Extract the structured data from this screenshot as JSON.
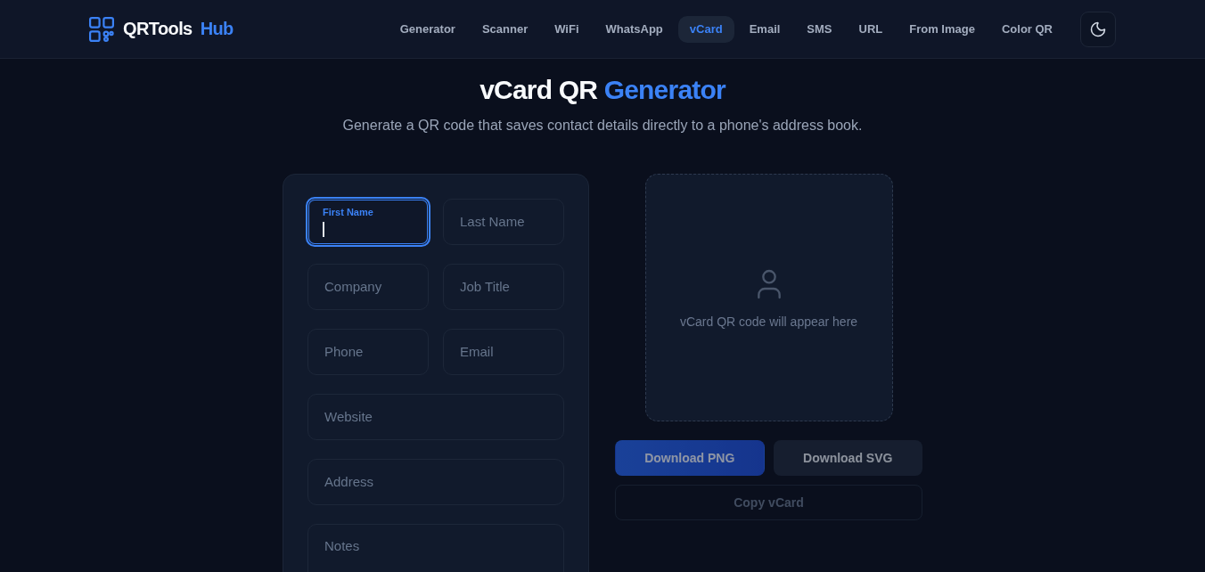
{
  "header": {
    "logo": {
      "name": "QRTools",
      "accent": "Hub"
    },
    "nav": [
      {
        "label": "Generator",
        "selected": false
      },
      {
        "label": "Scanner",
        "selected": false
      },
      {
        "label": "WiFi",
        "selected": false
      },
      {
        "label": "WhatsApp",
        "selected": false
      },
      {
        "label": "vCard",
        "selected": true
      },
      {
        "label": "Email",
        "selected": false
      },
      {
        "label": "SMS",
        "selected": false
      },
      {
        "label": "URL",
        "selected": false
      },
      {
        "label": "From Image",
        "selected": false
      },
      {
        "label": "Color QR",
        "selected": false
      }
    ]
  },
  "hero": {
    "title": "vCard QR",
    "title_accent": "Generator",
    "subtitle": "Generate a QR code that saves contact details directly to a phone's address book."
  },
  "form": {
    "rows": [
      {
        "fields": [
          {
            "label": "First Name",
            "kind": "text",
            "focused": true
          },
          {
            "label": "Last Name",
            "kind": "text",
            "focused": false
          }
        ]
      },
      {
        "fields": [
          {
            "label": "Company",
            "kind": "text",
            "focused": false
          },
          {
            "label": "Job Title",
            "kind": "text",
            "focused": false
          }
        ]
      },
      {
        "fields": [
          {
            "label": "Phone",
            "kind": "text",
            "focused": false
          },
          {
            "label": "Email",
            "kind": "text",
            "focused": false
          }
        ]
      },
      {
        "fields": [
          {
            "label": "Website",
            "kind": "text",
            "focused": false
          }
        ]
      },
      {
        "fields": [
          {
            "label": "Address",
            "kind": "text",
            "focused": false
          }
        ]
      },
      {
        "fields": [
          {
            "label": "Notes",
            "kind": "textarea",
            "focused": false
          }
        ]
      }
    ]
  },
  "preview": {
    "message": "vCard QR code will appear here"
  },
  "actions": [
    {
      "label": "Download PNG",
      "kind": "primary",
      "disabled": true
    },
    {
      "label": "Download SVG",
      "kind": "secondary",
      "disabled": true
    },
    {
      "label": "Copy vCard",
      "kind": "outline",
      "disabled": true
    }
  ]
}
